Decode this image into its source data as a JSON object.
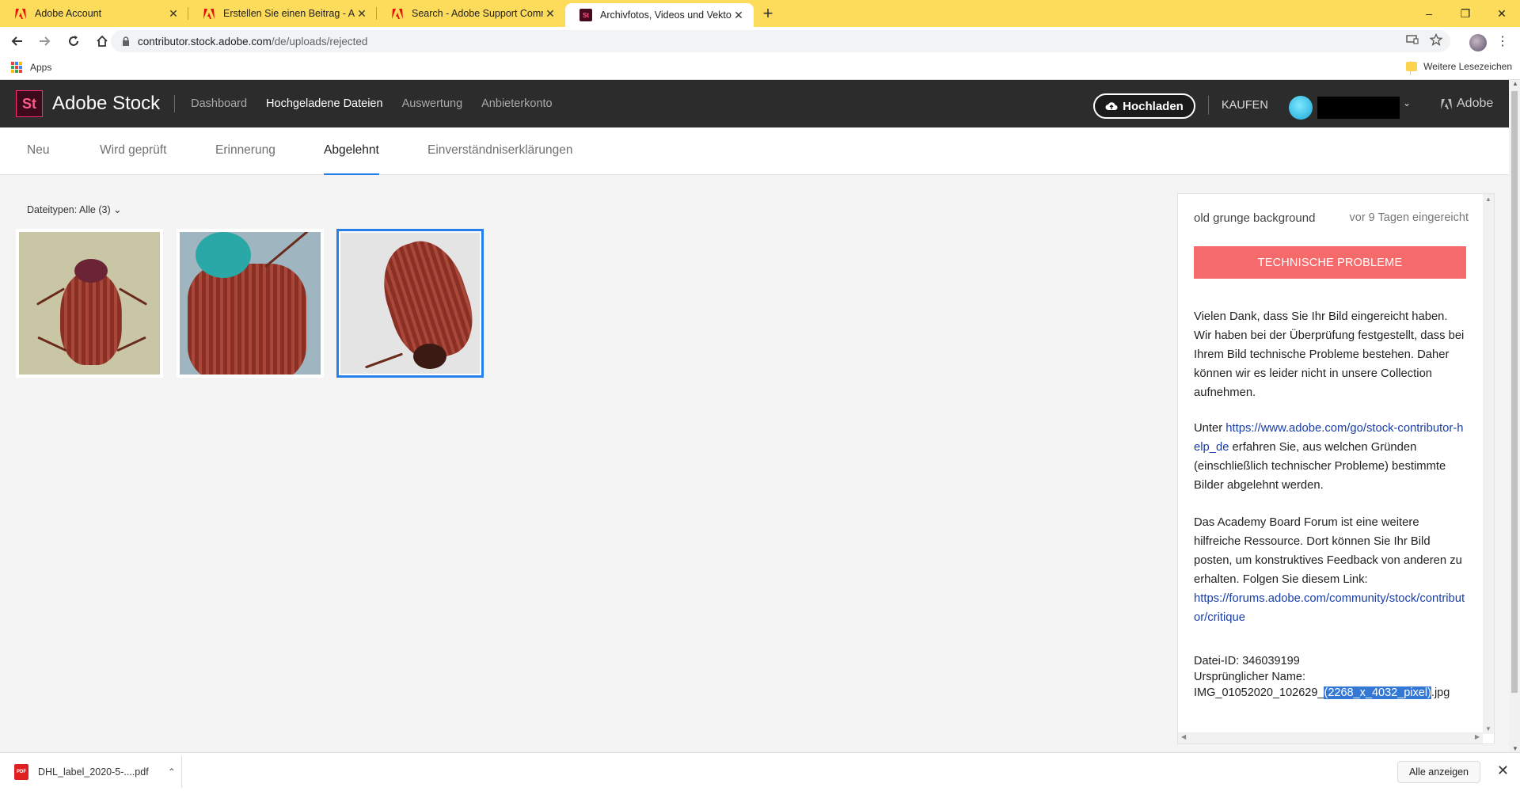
{
  "browser": {
    "tabs": [
      {
        "title": "Adobe Account",
        "favicon": "adobe-icon",
        "active": false
      },
      {
        "title": "Erstellen Sie einen Beitrag - Adob",
        "favicon": "adobe-icon",
        "active": false
      },
      {
        "title": "Search - Adobe Support Commu",
        "favicon": "adobe-icon",
        "active": false
      },
      {
        "title": "Archivfotos, Videos und Vektorg",
        "favicon": "adobe-stock-icon",
        "active": true
      }
    ],
    "url_host": "contributor.stock.adobe.com",
    "url_path": "/de/uploads/rejected",
    "bookmarks": {
      "apps_label": "Apps",
      "other_label": "Weitere Lesezeichen"
    },
    "window_controls": {
      "minimize": "–",
      "restore": "❐",
      "close": "✕"
    }
  },
  "stock": {
    "logo_text": "St",
    "brand": "Adobe Stock",
    "nav": [
      "Dashboard",
      "Hochgeladene Dateien",
      "Auswertung",
      "Anbieterkonto"
    ],
    "nav_current": "Hochgeladene Dateien",
    "upload_label": "Hochladen",
    "buy_label": "KAUFEN",
    "adobe_label": "Adobe",
    "tabs": [
      "Neu",
      "Wird geprüft",
      "Erinnerung",
      "Abgelehnt",
      "Einverständniserklärungen"
    ],
    "active_tab": "Abgelehnt",
    "filter_label": "Dateitypen: Alle (3)",
    "thumbnails": [
      {
        "selected": false,
        "icon": "beetle-photo"
      },
      {
        "selected": false,
        "icon": "beetle-photo"
      },
      {
        "selected": true,
        "icon": "beetle-photo"
      }
    ]
  },
  "panel": {
    "title": "old grunge background",
    "submitted": "vor 9 Tagen eingereicht",
    "status": "TECHNISCHE PROBLEME",
    "para1": "Vielen Dank, dass Sie Ihr Bild eingereicht haben. Wir haben bei der Überprüfung festgestellt, dass bei Ihrem Bild technische Probleme bestehen. Daher können wir es leider nicht in unsere Collection aufnehmen.",
    "para2_prefix": "Unter ",
    "para2_link": "https://www.adobe.com/go/stock-contributor-help_de",
    "para2_suffix": " erfahren Sie, aus welchen Gründen (einschließlich technischer Probleme) bestimmte Bilder abgelehnt werden.",
    "para3": "Das Academy Board Forum ist eine weitere hilfreiche Ressource. Dort können Sie Ihr Bild posten, um konstruktives Feedback von anderen zu erhalten. Folgen Sie diesem Link:",
    "para3_link": "https://forums.adobe.com/community/stock/contributor/critique",
    "file_id": "Datei-ID: 346039199",
    "orig_label": "Ursprünglicher Name:",
    "orig_prefix": "IMG_01052020_102629_",
    "orig_highlight": "(2268_x_4032_pixel)",
    "orig_suffix": ".jpg"
  },
  "downloads": {
    "file": "DHL_label_2020-5-....pdf",
    "file_badge": "PDF",
    "show_all": "Alle anzeigen"
  },
  "colors": {
    "tabbar": "#fddb5b",
    "status_red": "#f56a6a",
    "accent_blue": "#2680eb",
    "header_dark": "#2c2c2c"
  }
}
